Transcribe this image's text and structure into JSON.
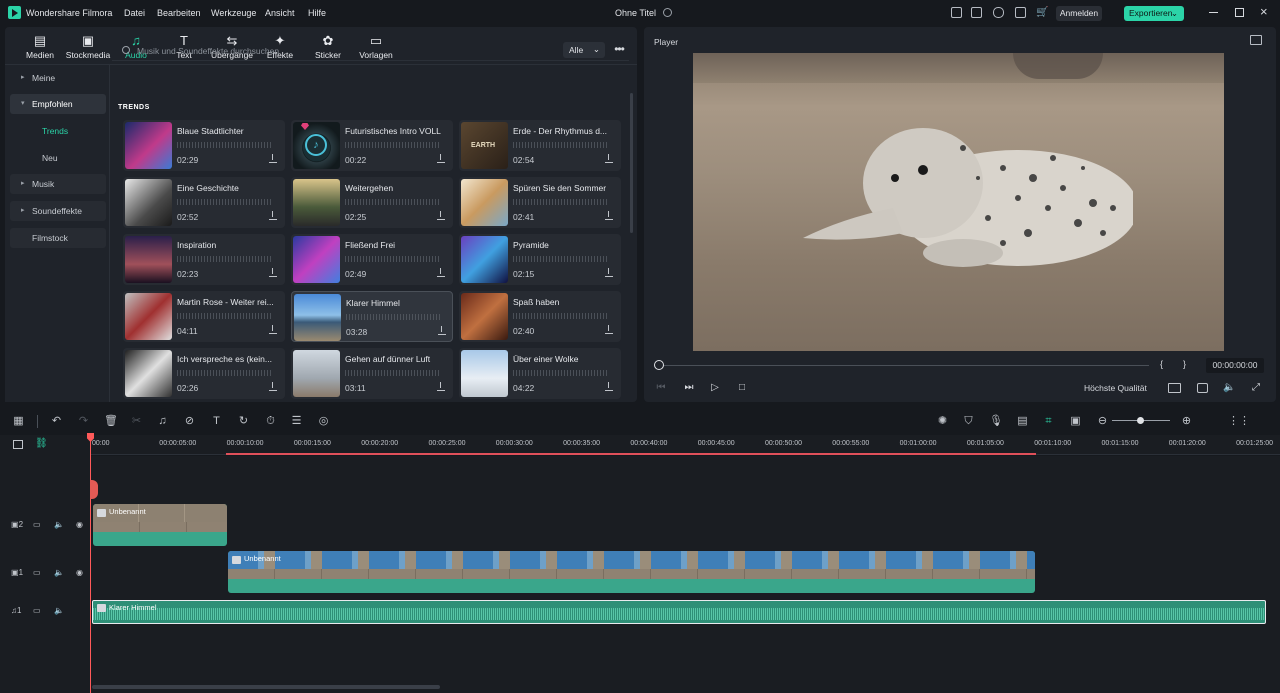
{
  "app": {
    "name": "Wondershare Filmora",
    "document_title": "Ohne Titel"
  },
  "menu": [
    "Datei",
    "Bearbeiten",
    "Werkzeuge",
    "Ansicht",
    "Hilfe"
  ],
  "header": {
    "login_label": "Anmelden",
    "export_label": "Exportieren"
  },
  "toolbar_tabs": [
    {
      "label": "Medien",
      "icon": "media-icon"
    },
    {
      "label": "Stockmedia",
      "icon": "stock-media-icon"
    },
    {
      "label": "Audio",
      "icon": "music-note-icon"
    },
    {
      "label": "Text",
      "icon": "text-icon"
    },
    {
      "label": "Übergänge",
      "icon": "transitions-icon"
    },
    {
      "label": "Effekte",
      "icon": "effects-icon"
    },
    {
      "label": "Sticker",
      "icon": "sticker-icon"
    },
    {
      "label": "Vorlagen",
      "icon": "templates-icon"
    }
  ],
  "sidebar": {
    "items": [
      {
        "label": "Meine"
      },
      {
        "label": "Empfohlen"
      },
      {
        "label": "Trends"
      },
      {
        "label": "Neu"
      },
      {
        "label": "Musik"
      },
      {
        "label": "Soundeffekte"
      },
      {
        "label": "Filmstock"
      }
    ]
  },
  "search": {
    "placeholder": "Musik und Soundeffekte durchsuchen",
    "filter_value": "Alle"
  },
  "section_title": "TRENDS",
  "tracks": [
    {
      "title": "Blaue Stadtlichter",
      "duration": "02:29"
    },
    {
      "title": "Futuristisches Intro VOLL",
      "duration": "00:22"
    },
    {
      "title": "Erde - Der Rhythmus d...",
      "duration": "02:54"
    },
    {
      "title": "Eine Geschichte",
      "duration": "02:52"
    },
    {
      "title": "Weitergehen",
      "duration": "02:25"
    },
    {
      "title": "Spüren Sie den Sommer",
      "duration": "02:41"
    },
    {
      "title": "Inspiration",
      "duration": "02:23"
    },
    {
      "title": "Fließend Frei",
      "duration": "02:49"
    },
    {
      "title": "Pyramide",
      "duration": "02:15"
    },
    {
      "title": "Martin Rose - Weiter rei...",
      "duration": "04:11"
    },
    {
      "title": "Klarer Himmel",
      "duration": "03:28"
    },
    {
      "title": "Spaß haben",
      "duration": "02:40"
    },
    {
      "title": "Ich verspreche es (kein...",
      "duration": "02:26"
    },
    {
      "title": "Gehen auf dünner Luft",
      "duration": "03:11"
    },
    {
      "title": "Über einer Wolke",
      "duration": "04:22"
    }
  ],
  "thumb_text": "EARTH",
  "player": {
    "title": "Player",
    "timecode": "00:00:00:00",
    "quality": "Höchste Qualität",
    "bracket_in": "{",
    "bracket_out": "}"
  },
  "timeline": {
    "ruler_labels": [
      "00:00",
      "00:00:05:00",
      "00:00:10:00",
      "00:00:15:00",
      "00:00:20:00",
      "00:00:25:00",
      "00:00:30:00",
      "00:00:35:00",
      "00:00:40:00",
      "00:00:45:00",
      "00:00:50:00",
      "00:00:55:00",
      "00:01:00:00",
      "00:01:05:00",
      "00:01:10:00",
      "00:01:15:00",
      "00:01:20:00",
      "00:01:25:00"
    ],
    "clip_v2_label": "Unbenannt",
    "clip_v1_label": "Unbenannt",
    "audio_clip_label": "Klarer Himmel",
    "track_numbers": [
      "2",
      "1",
      "1"
    ]
  }
}
